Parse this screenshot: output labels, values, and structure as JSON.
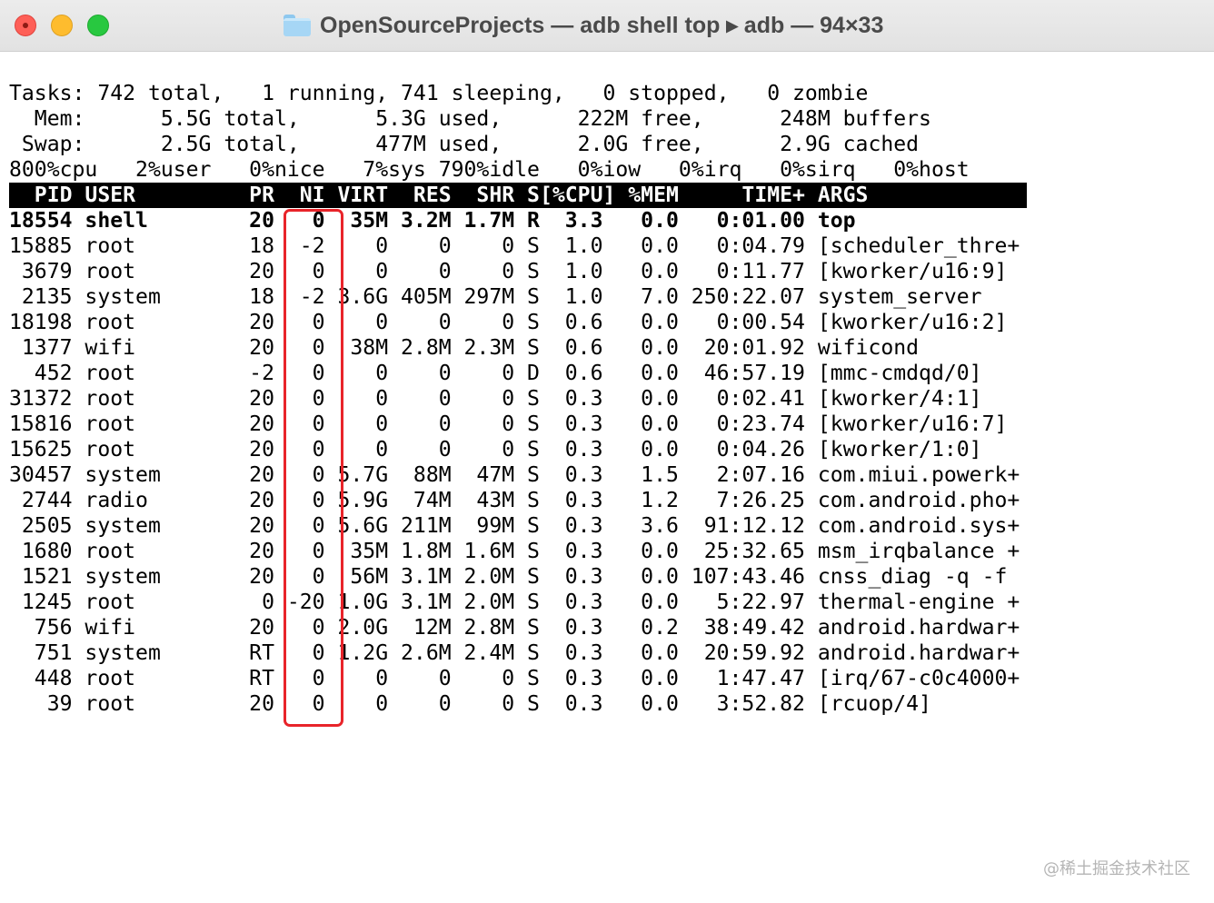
{
  "window": {
    "title": "OpenSourceProjects — adb shell top ▸ adb — 94×33",
    "colors": {
      "close": "#fe5f57",
      "minimize": "#febc2e",
      "maximize": "#28c840",
      "highlight": "#e8242a"
    }
  },
  "summary": {
    "tasks": "Tasks: 742 total,   1 running, 741 sleeping,   0 stopped,   0 zombie",
    "mem": "  Mem:      5.5G total,      5.3G used,      222M free,      248M buffers",
    "swap": " Swap:      2.5G total,      477M used,      2.0G free,      2.9G cached",
    "cpu": "800%cpu   2%user   0%nice   7%sys 790%idle   0%iow   0%irq   0%sirq   0%host"
  },
  "table": {
    "header": "  PID USER         PR  NI VIRT  RES  SHR S[%CPU] %MEM     TIME+ ARGS",
    "rows": [
      "18554 shell        20   0  35M 3.2M 1.7M R  3.3   0.0   0:01.00 top",
      "15885 root         18  -2    0    0    0 S  1.0   0.0   0:04.79 [scheduler_thre+",
      " 3679 root         20   0    0    0    0 S  1.0   0.0   0:11.77 [kworker/u16:9]",
      " 2135 system       18  -2 3.6G 405M 297M S  1.0   7.0 250:22.07 system_server",
      "18198 root         20   0    0    0    0 S  0.6   0.0   0:00.54 [kworker/u16:2]",
      " 1377 wifi         20   0  38M 2.8M 2.3M S  0.6   0.0  20:01.92 wificond",
      "  452 root         -2   0    0    0    0 D  0.6   0.0  46:57.19 [mmc-cmdqd/0]",
      "31372 root         20   0    0    0    0 S  0.3   0.0   0:02.41 [kworker/4:1]",
      "15816 root         20   0    0    0    0 S  0.3   0.0   0:23.74 [kworker/u16:7]",
      "15625 root         20   0    0    0    0 S  0.3   0.0   0:04.26 [kworker/1:0]",
      "30457 system       20   0 5.7G  88M  47M S  0.3   1.5   2:07.16 com.miui.powerk+",
      " 2744 radio        20   0 5.9G  74M  43M S  0.3   1.2   7:26.25 com.android.pho+",
      " 2505 system       20   0 5.6G 211M  99M S  0.3   3.6  91:12.12 com.android.sys+",
      " 1680 root         20   0  35M 1.8M 1.6M S  0.3   0.0  25:32.65 msm_irqbalance +",
      " 1521 system       20   0  56M 3.1M 2.0M S  0.3   0.0 107:43.46 cnss_diag -q -f",
      " 1245 root          0 -20 1.0G 3.1M 2.0M S  0.3   0.0   5:22.97 thermal-engine +",
      "  756 wifi         20   0 2.0G  12M 2.8M S  0.3   0.2  38:49.42 android.hardwar+",
      "  751 system       RT   0 1.2G 2.6M 2.4M S  0.3   0.0  20:59.92 android.hardwar+",
      "  448 root         RT   0    0    0    0 S  0.3   0.0   1:47.47 [irq/67-c0c4000+",
      "   39 root         20   0    0    0    0 S  0.3   0.0   3:52.82 [rcuop/4]"
    ]
  },
  "watermark": "@稀土掘金技术社区"
}
